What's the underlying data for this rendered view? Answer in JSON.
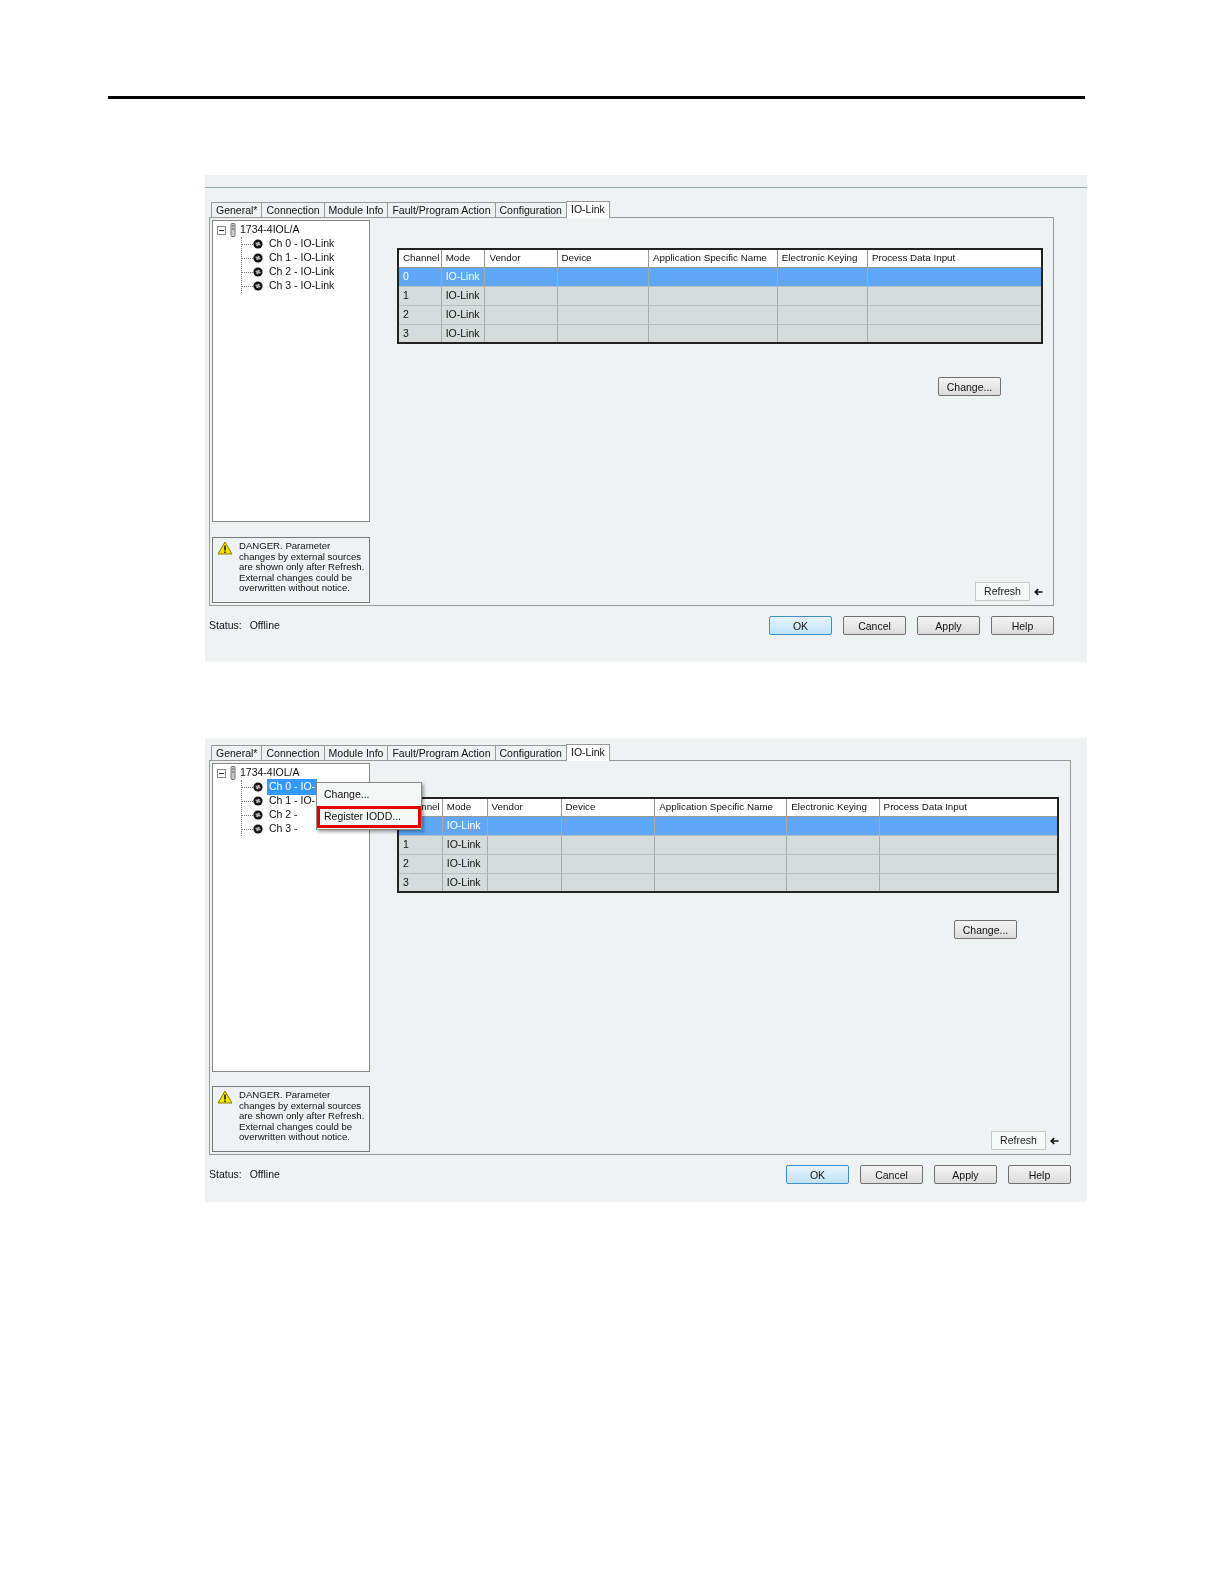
{
  "dialogs": [
    {
      "tabs": [
        {
          "label": "General*",
          "selected": false
        },
        {
          "label": "Connection",
          "selected": false
        },
        {
          "label": "Module Info",
          "selected": false
        },
        {
          "label": "Fault/Program Action",
          "selected": false
        },
        {
          "label": "Configuration",
          "selected": false
        },
        {
          "label": "IO-Link",
          "selected": true
        }
      ],
      "tree": {
        "label": "1734-4IOL/A",
        "expanded": true,
        "children": [
          {
            "label": "Ch 0 - IO-Link",
            "selected": false
          },
          {
            "label": "Ch 1 - IO-Link",
            "selected": false
          },
          {
            "label": "Ch 2 - IO-Link",
            "selected": false
          },
          {
            "label": "Ch 3 - IO-Link",
            "selected": false
          }
        ]
      },
      "warning": "DANGER. Parameter changes by external sources are shown only after Refresh. External changes could be overwritten without notice.",
      "table": {
        "columns": [
          "Channel",
          "Mode",
          "Vendor",
          "Device",
          "Application Specific Name",
          "Electronic Keying",
          "Process Data Input"
        ],
        "rows": [
          {
            "channel": "0",
            "mode": "IO-Link",
            "selected": true
          },
          {
            "channel": "1",
            "mode": "IO-Link",
            "selected": false
          },
          {
            "channel": "2",
            "mode": "IO-Link",
            "selected": false
          },
          {
            "channel": "3",
            "mode": "IO-Link",
            "selected": false
          }
        ]
      },
      "change_button": "Change...",
      "refresh_button": "Refresh",
      "status_label": "Status:",
      "status_value": "Offline",
      "buttons": [
        {
          "label": "OK",
          "default": true
        },
        {
          "label": "Cancel",
          "default": false
        },
        {
          "label": "Apply",
          "default": false
        },
        {
          "label": "Help",
          "default": false
        }
      ]
    },
    {
      "tabs": [
        {
          "label": "General*",
          "selected": false
        },
        {
          "label": "Connection",
          "selected": false
        },
        {
          "label": "Module Info",
          "selected": false
        },
        {
          "label": "Fault/Program Action",
          "selected": false
        },
        {
          "label": "Configuration",
          "selected": false
        },
        {
          "label": "IO-Link",
          "selected": true
        }
      ],
      "tree": {
        "label": "1734-4IOL/A",
        "expanded": true,
        "children": [
          {
            "label": "Ch 0 - IO-",
            "selected": true
          },
          {
            "label": "Ch 1 - IO-",
            "selected": false
          },
          {
            "label": "Ch 2 -",
            "selected": false
          },
          {
            "label": "Ch 3 -",
            "selected": false
          }
        ]
      },
      "context_menu": [
        {
          "label": "Change...",
          "callout": false
        },
        {
          "label": "Register IODD...",
          "callout": true
        }
      ],
      "warning": "DANGER. Parameter changes by external sources are shown only after Refresh. External changes could be overwritten without notice.",
      "table": {
        "columns": [
          "nnel",
          "Mode",
          "Vendor",
          "Device",
          "Application Specific Name",
          "Electronic Keying",
          "Process Data Input"
        ],
        "rows": [
          {
            "mode": "IO-Link",
            "selected": true
          },
          {
            "channel": "1",
            "mode": "IO-Link",
            "selected": false
          },
          {
            "channel": "2",
            "mode": "IO-Link",
            "selected": false
          },
          {
            "channel": "3",
            "mode": "IO-Link",
            "selected": false
          }
        ]
      },
      "change_button": "Change...",
      "refresh_button": "Refresh",
      "status_label": "Status:",
      "status_value": "Offline",
      "buttons": [
        {
          "label": "OK",
          "default": true
        },
        {
          "label": "Cancel",
          "default": false
        },
        {
          "label": "Apply",
          "default": false
        },
        {
          "label": "Help",
          "default": false
        }
      ]
    }
  ]
}
